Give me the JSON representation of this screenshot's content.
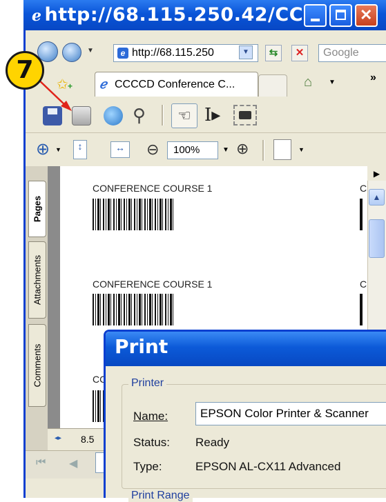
{
  "window": {
    "title": "http://68.115.250.42/CC...",
    "address": "http://68.115.250",
    "search_placeholder": "Google",
    "tab_label": "CCCCD Conference C...",
    "more_label": "»"
  },
  "callout": {
    "number": "7",
    "color": "#ffd400",
    "arrow_color": "#e0241b"
  },
  "pdf_toolbar": {
    "icons": [
      "save-icon",
      "print-icon",
      "email-icon",
      "search-icon",
      "hand-tool-icon",
      "select-text-icon",
      "snapshot-icon"
    ],
    "zoom_value": "100%"
  },
  "side_tabs": [
    "Pages",
    "Attachments",
    "Comments"
  ],
  "document": {
    "entries": [
      {
        "label": "CONFERENCE COURSE 1",
        "partial": "C"
      },
      {
        "label": "CONFERENCE COURSE 1",
        "partial": "C"
      },
      {
        "label": "CC",
        "partial": ""
      }
    ],
    "page_size": "8.5"
  },
  "print_dialog": {
    "title": "Print",
    "printer_group": "Printer",
    "name_label": "Name:",
    "name_value": "EPSON Color Printer & Scanner",
    "status_label": "Status:",
    "status_value": "Ready",
    "type_label": "Type:",
    "type_value": "EPSON AL-CX11 Advanced",
    "range_group": "Print Range"
  },
  "colors": {
    "titlebar": "#0a55d8",
    "chrome": "#ece9d8"
  }
}
